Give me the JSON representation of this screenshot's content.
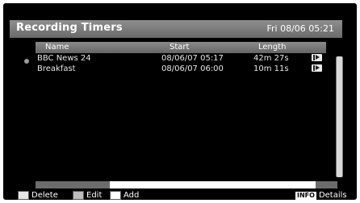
{
  "header": {
    "title": "Recording Timers",
    "datetime": "Fri 08/06 05:21"
  },
  "columns": {
    "name": "Name",
    "start": "Start",
    "length": "Length"
  },
  "recordings": [
    {
      "name": "BBC News 24",
      "start": "08/06/07  05:17",
      "length": "42m 27s",
      "icon": "play-icon"
    },
    {
      "name": "Breakfast",
      "start": "08/06/07  06:00",
      "length": "10m 11s",
      "icon": "play-icon"
    }
  ],
  "footer": {
    "delete_label": "Delete",
    "edit_label": "Edit",
    "add_label": "Add",
    "info_key": "INFO",
    "details_label": "Details"
  },
  "colors": {
    "delete_key": "#e6e6e6",
    "edit_key": "#bdbdbd",
    "add_key": "#ffffff"
  }
}
